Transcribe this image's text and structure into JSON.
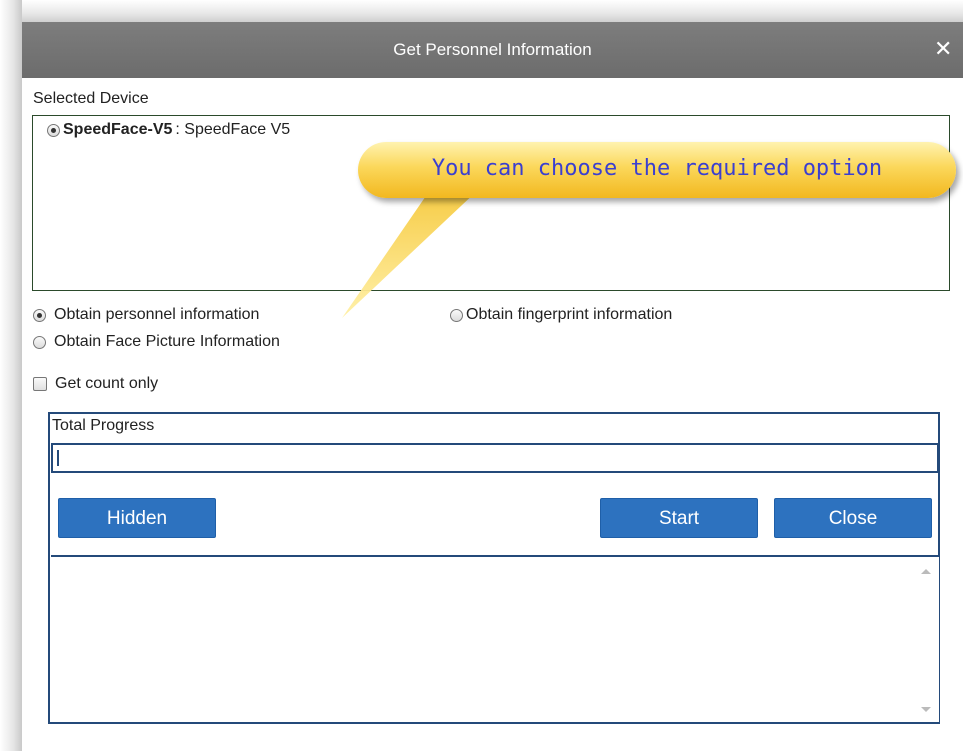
{
  "dialog": {
    "title": "Get Personnel Information",
    "close_symbol": "✕"
  },
  "selected_device": {
    "label": "Selected Device",
    "device_name": "SpeedFace-V5",
    "device_model": " : SpeedFace V5"
  },
  "options": {
    "personnel": "Obtain personnel information",
    "fingerprint": "Obtain fingerprint information",
    "face_picture": "Obtain Face Picture Information",
    "count_only": "Get count only",
    "selected": "personnel"
  },
  "progress": {
    "label": "Total Progress",
    "value": 0
  },
  "buttons": {
    "hidden": "Hidden",
    "start": "Start",
    "close": "Close"
  },
  "callout": {
    "text": "You can choose the required option"
  },
  "colors": {
    "title_bar": "#6f6f6f",
    "button_blue": "#2d72bf",
    "border_navy": "#244a7a",
    "callout_yellow": "#f8cf45",
    "callout_text": "#3b3fd0"
  }
}
